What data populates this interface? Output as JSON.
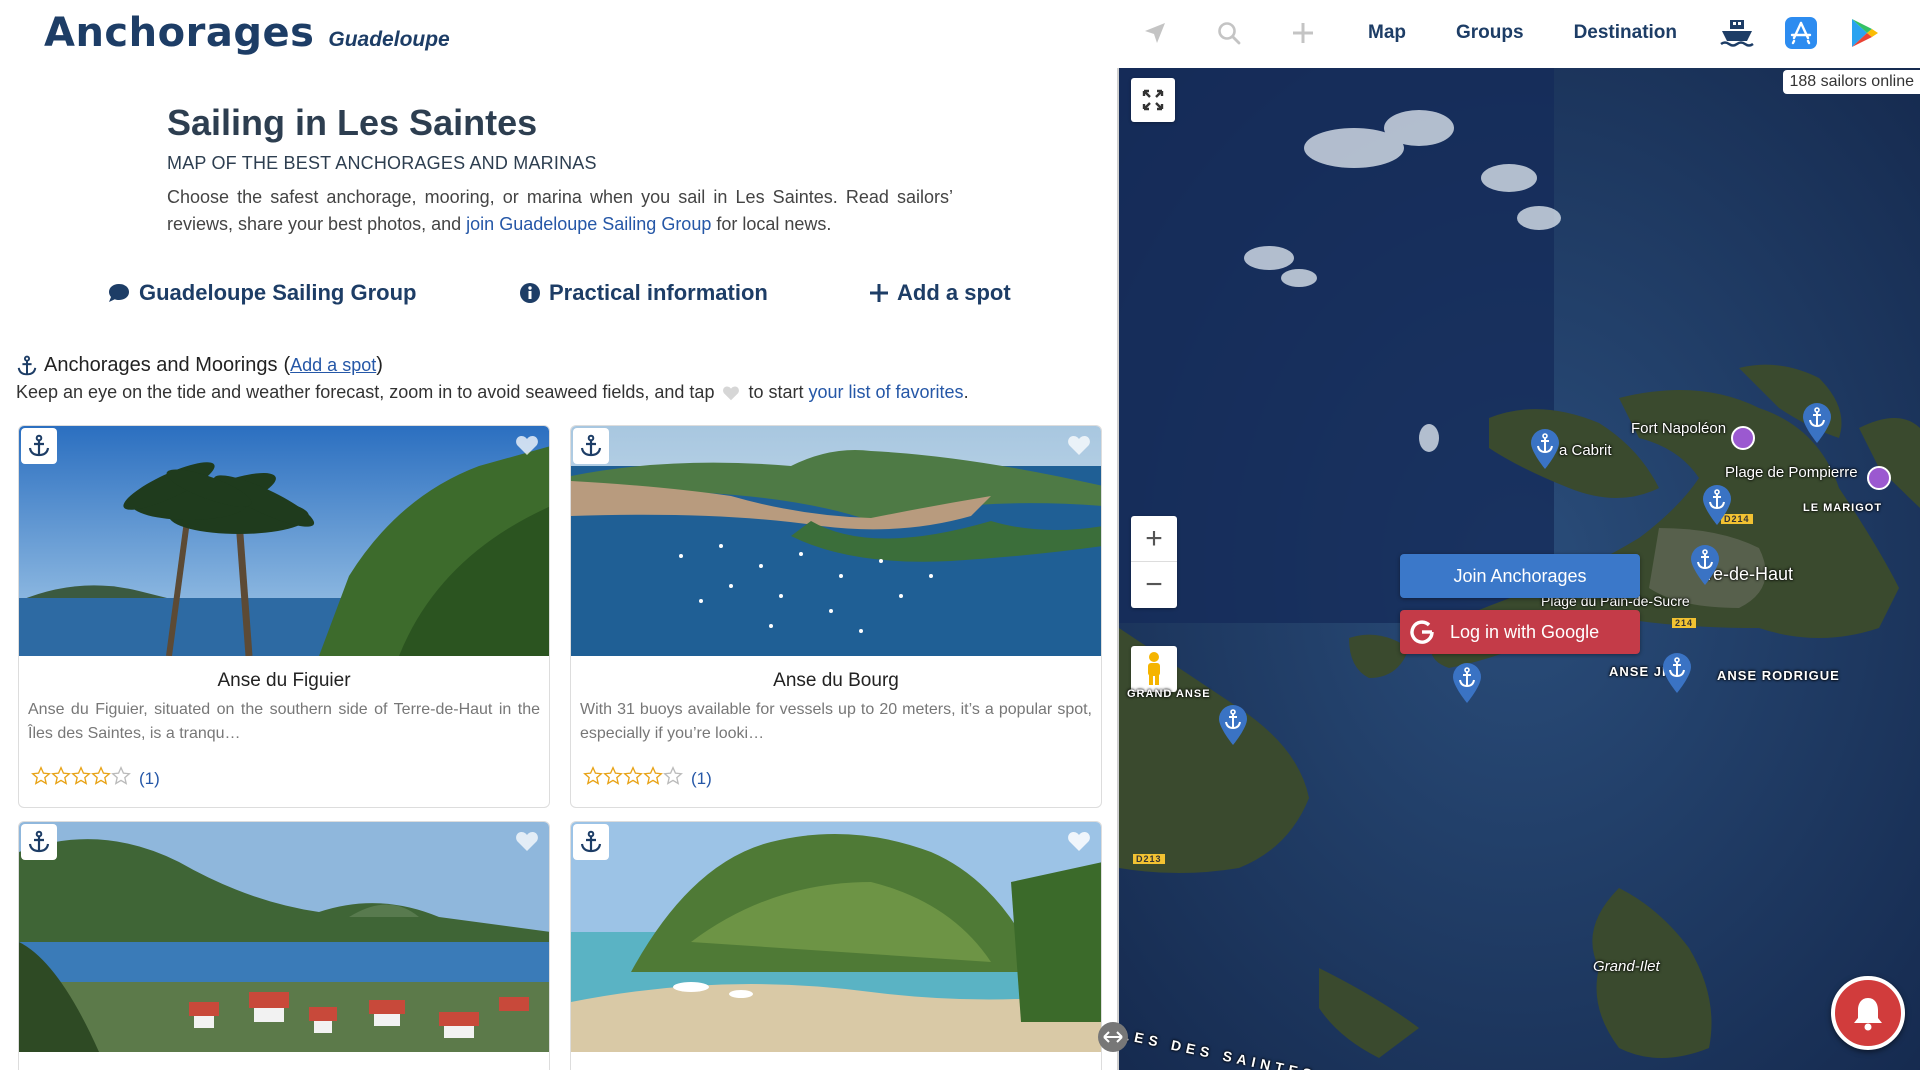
{
  "header": {
    "brand": "Anchorages",
    "region": "Guadeloupe",
    "nav": [
      "Map",
      "Groups",
      "Destination"
    ],
    "icons": [
      "locate-arrow-icon",
      "search-icon",
      "plus-icon",
      "boat-icon",
      "app-store-icon",
      "google-play-icon"
    ]
  },
  "intro": {
    "title": "Sailing in Les Saintes",
    "subtitle": "Map of the best anchorages and marinas",
    "text_before": "Choose the safest anchorage, mooring, or marina when you sail in Les Saintes. Read sailors’ reviews, share your best photos, and ",
    "link": "join Guadeloupe Sailing Group",
    "text_after": " for local news."
  },
  "actions": {
    "group": "Guadeloupe Sailing Group",
    "info": "Practical information",
    "add": "Add a spot"
  },
  "section": {
    "title": "Anchorages and Moorings",
    "add_link": "Add a spot",
    "desc_before": "Keep an eye on the tide and weather forecast, zoom in to avoid seaweed fields, and tap ",
    "desc_middle": " to start ",
    "desc_link": "your list of favorites",
    "desc_end": "."
  },
  "cards": [
    {
      "title": "Anse du Figuier",
      "text": "Anse du Figuier, situated on the southern side of Terre-de-Haut in the Îles des Saintes, is a tranqu…",
      "stars": 4,
      "count": "(1)"
    },
    {
      "title": "Anse du Bourg",
      "text": "With 31 buoys available for vessels up to 20 meters, it’s a popular spot, especially if you’re looki…",
      "stars": 4,
      "count": "(1)"
    },
    {
      "title": "",
      "text": "",
      "stars": 0,
      "count": ""
    },
    {
      "title": "",
      "text": "",
      "stars": 0,
      "count": ""
    }
  ],
  "map": {
    "online": "188 sailors online",
    "labels": {
      "cabrit": "a Cabrit",
      "fort": "Fort Napoléon",
      "pompierre": "Plage de Pompierre",
      "marigot": "LE MARIGOT",
      "terre": "re-de-Haut",
      "pain": "Plage du Pain-de-Sucre",
      "anse_jier": "ANSE    JIER",
      "rodrigue": "ANSE RODRIGUE",
      "grand_anse": "GRAND ANSE",
      "grand_ilet": "Grand-Ilet",
      "saintes": "LES DES SAINTES",
      "d214": "D214",
      "d214b": "214",
      "d213": "D213"
    },
    "join": "Join Anchorages",
    "google": "Log in with Google"
  },
  "colors": {
    "brand": "#1d3d66",
    "link": "#2557a7",
    "star": "#e8a317",
    "join": "#3b78c9",
    "google": "#c43b48",
    "pin": "#3a73c4"
  }
}
